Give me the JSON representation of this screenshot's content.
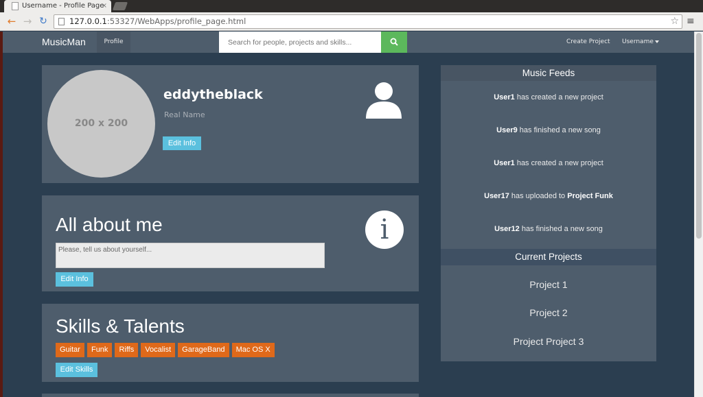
{
  "browser": {
    "tab_title": "Username - Profile Page",
    "tab_close": "×",
    "url_host": "127.0.0.1",
    "url_rest": ":53327/WebApps/profile_page.html"
  },
  "navbar": {
    "brand": "MusicMan",
    "profile_link": "Profile",
    "search_placeholder": "Search for people, projects and skills...",
    "create_project": "Create Project",
    "username": "Username"
  },
  "profile": {
    "avatar_placeholder": "200 x 200",
    "username": "eddytheblack",
    "real_name": "Real Name",
    "edit_button": "Edit Info"
  },
  "about": {
    "title": "All about me",
    "placeholder": "Please, tell us about yourself...",
    "edit_button": "Edit Info",
    "icon": "i"
  },
  "skills": {
    "title": "Skills & Talents",
    "tags": [
      "Guitar",
      "Funk",
      "Riffs",
      "Vocalist",
      "GarageBand",
      "Mac OS X"
    ],
    "edit_button": "Edit Skills"
  },
  "music_feeds": {
    "title": "Music Feeds",
    "items": [
      {
        "user": "User1",
        "text": " has created a new project",
        "target": ""
      },
      {
        "user": "User9",
        "text": " has finished a new song",
        "target": ""
      },
      {
        "user": "User1",
        "text": " has created a new project",
        "target": ""
      },
      {
        "user": "User17",
        "text": " has uploaded to ",
        "target": "Project Funk"
      },
      {
        "user": "User12",
        "text": " has finished a new song",
        "target": ""
      }
    ]
  },
  "current_projects": {
    "title": "Current Projects",
    "items": [
      "Project 1",
      "Project 2",
      "Project Project 3"
    ]
  },
  "colors": {
    "background": "#2b3e50",
    "panel": "#4e5d6c",
    "accent_info": "#5bc0de",
    "tag_orange": "#df691a",
    "search_green": "#5cb85c"
  }
}
